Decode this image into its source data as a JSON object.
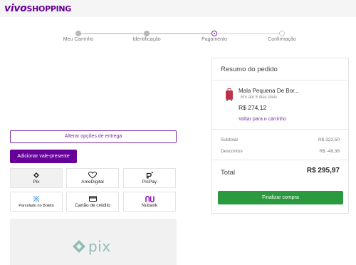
{
  "brand": {
    "vivo": "vivo",
    "shopping": "SHOPPING"
  },
  "stepper": {
    "steps": [
      {
        "label": "Meu Carrinho",
        "state": "done"
      },
      {
        "label": "Identificação",
        "state": "done"
      },
      {
        "label": "Pagamento",
        "state": "active"
      },
      {
        "label": "Confirmação",
        "state": "todo"
      }
    ]
  },
  "delivery": {
    "change_label": "Alterar opções de entrega"
  },
  "gift": {
    "add_label": "Adicionar vale-presente"
  },
  "payment_methods": [
    {
      "label": "Pix",
      "icon": "pix-icon",
      "selected": true
    },
    {
      "label": "AmeDigital",
      "icon": "ame-icon",
      "selected": false
    },
    {
      "label": "PicPay",
      "icon": "picpay-icon",
      "selected": false
    },
    {
      "label": "Parcelado no Boleto",
      "icon": "boleto-icon",
      "selected": false
    },
    {
      "label": "Cartão de crédito",
      "icon": "credit-card-icon",
      "selected": false
    },
    {
      "label": "Nubank",
      "icon": "nubank-icon",
      "selected": false
    }
  ],
  "pix_panel": {
    "logo_text": "pix"
  },
  "summary": {
    "title": "Resumo do pedido",
    "product": {
      "name": "Mala Pequena De Bor...",
      "shipping": "Em até 5 dias úteis",
      "price": "R$ 274,12"
    },
    "back_to_cart": "Voltar para o carrinho",
    "subtotal_label": "Subtotal",
    "subtotal_value": "R$ 322,50",
    "discounts_label": "Descontos",
    "discounts_value": "R$ -48,38",
    "total_label": "Total",
    "total_value": "R$ 295,97",
    "finalize_label": "Finalizar compra"
  },
  "colors": {
    "brand_purple": "#660099",
    "accent_purple": "#7a2ca8",
    "green": "#2b9a3f"
  }
}
